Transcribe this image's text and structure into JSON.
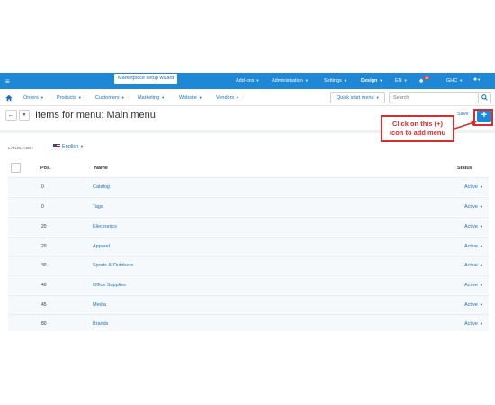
{
  "topbar": {
    "wizard_tooltip": "Marketplace setup wizard",
    "items": [
      {
        "label": "Add-ons"
      },
      {
        "label": "Administration"
      },
      {
        "label": "Settings"
      },
      {
        "label": "Design"
      },
      {
        "label": "EN"
      },
      {
        "label": "GHC"
      }
    ],
    "notification_count": "45"
  },
  "nav": {
    "items": [
      {
        "label": "Orders"
      },
      {
        "label": "Products"
      },
      {
        "label": "Customers"
      },
      {
        "label": "Marketing"
      },
      {
        "label": "Website"
      },
      {
        "label": "Vendors"
      }
    ],
    "quick_start": "Quick start menu",
    "search_placeholder": "Search"
  },
  "page": {
    "title": "Items for menu: Main menu",
    "save_label": "Save",
    "add_label": "+"
  },
  "callout": {
    "line1": "Click on this (+)",
    "line2": "icon to add menu"
  },
  "filters": {
    "language_label": "LANGUAGE:",
    "language_value": "English"
  },
  "table": {
    "headers": {
      "pos": "Pos.",
      "name": "Name",
      "status": "Status"
    },
    "rows": [
      {
        "pos": "0",
        "name": "Catalog",
        "status": "Active"
      },
      {
        "pos": "0",
        "name": "Tags",
        "status": "Active"
      },
      {
        "pos": "20",
        "name": "Electronics",
        "status": "Active"
      },
      {
        "pos": "20",
        "name": "Apparel",
        "status": "Active"
      },
      {
        "pos": "30",
        "name": "Sports & Outdoors",
        "status": "Active"
      },
      {
        "pos": "40",
        "name": "Office Supplies",
        "status": "Active"
      },
      {
        "pos": "45",
        "name": "Media",
        "status": "Active"
      },
      {
        "pos": "80",
        "name": "Brands",
        "status": "Active"
      }
    ]
  },
  "colors": {
    "brand_blue": "#1e88d6",
    "link_blue": "#1e6fb5",
    "callout_red": "#d32f2f"
  }
}
